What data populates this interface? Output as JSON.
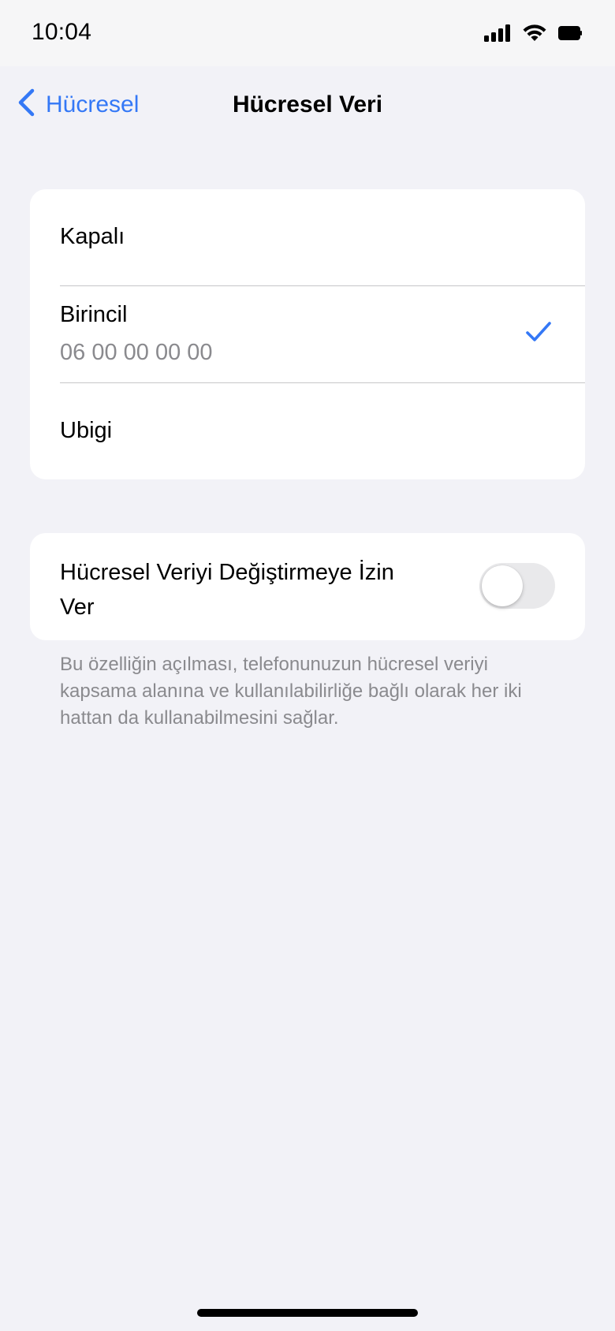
{
  "status_bar": {
    "time": "10:04",
    "icons": [
      "cellular-signal-icon",
      "wifi-icon",
      "battery-icon"
    ]
  },
  "nav": {
    "back_label": "Hücresel",
    "title": "Hücresel Veri"
  },
  "sim_options": [
    {
      "label": "Kapalı",
      "sub": ""
    },
    {
      "label": "Birincil",
      "sub": "06 00 00 00 00",
      "selected": true
    },
    {
      "label": "Ubigi",
      "sub": ""
    }
  ],
  "toggle_setting": {
    "label": "Hücresel Veriyi Değiştirmeye İzin Ver",
    "enabled": false
  },
  "footer_note": "Bu özelliğin açılması, telefonunuzun hücresel veriyi kapsama alanına ve kullanılabilirliğe bağlı olarak her iki hattan da kullanabilmesini sağlar.",
  "colors": {
    "accent": "#3478f6",
    "background": "#f2f2f7",
    "secondary_text": "#8a8a8e",
    "toggle_off": "#e9e9eb"
  }
}
